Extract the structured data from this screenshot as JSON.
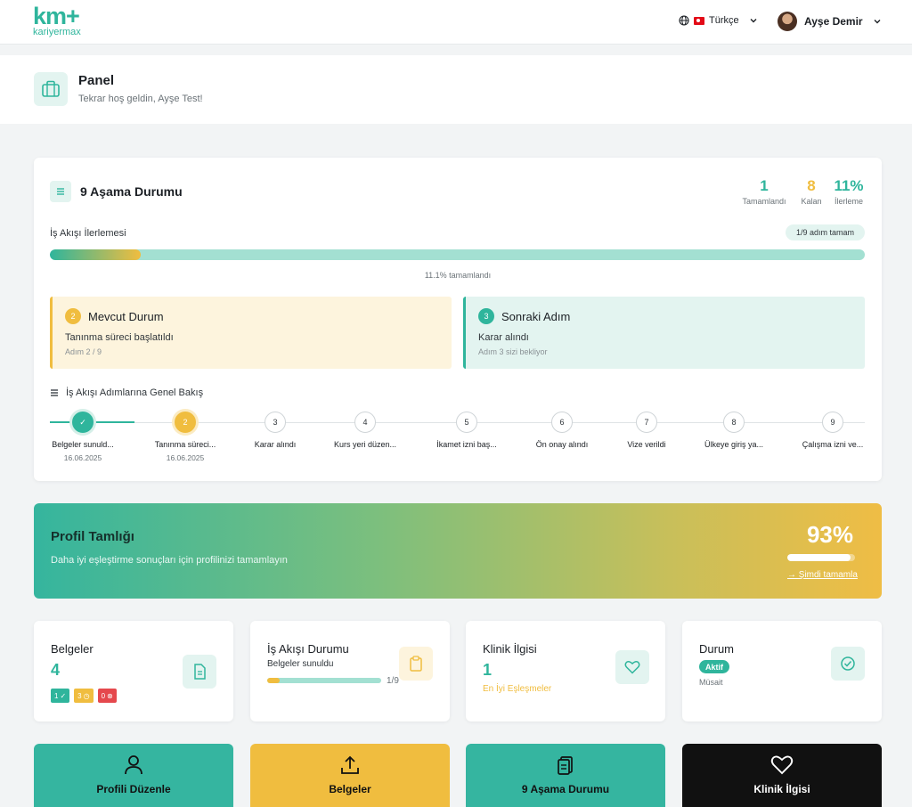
{
  "brand": {
    "logo": "km+",
    "name": "kariyermax"
  },
  "topbar": {
    "language": "Türkçe",
    "user_name": "Ayşe Demir"
  },
  "page": {
    "title": "Panel",
    "subtitle": "Tekrar hoş geldin, Ayşe Test!"
  },
  "stages": {
    "title": "9 Aşama Durumu",
    "stats": [
      {
        "value": "1",
        "label": "Tamamlandı",
        "color": "#2fb59c"
      },
      {
        "value": "8",
        "label": "Kalan",
        "color": "#f0bd3f"
      },
      {
        "value": "11%",
        "label": "İlerleme",
        "color": "#2fb59c"
      }
    ],
    "workflow_label": "İş Akışı İlerlemesi",
    "steps_done_pill": "1/9 adım tamam",
    "progress_fraction": 0.111,
    "progress_text": "11.1% tamamlandı",
    "current": {
      "badge": "2",
      "heading": "Mevcut Durum",
      "line1": "Tanınma süreci başlatıldı",
      "line2": "Adım 2 / 9"
    },
    "next": {
      "badge": "3",
      "heading": "Sonraki Adım",
      "line1": "Karar alındı",
      "line2": "Adım 3 sizi bekliyor"
    },
    "overview_title": "İş Akışı Adımlarına Genel Bakış",
    "steps": [
      {
        "num": "✓",
        "name": "Belgeler sunuld...",
        "date": "16.06.2025",
        "state": "done"
      },
      {
        "num": "2",
        "name": "Tanınma süreci...",
        "date": "16.06.2025",
        "state": "current"
      },
      {
        "num": "3",
        "name": "Karar alındı",
        "date": "",
        "state": "pending"
      },
      {
        "num": "4",
        "name": "Kurs yeri düzen...",
        "date": "",
        "state": "pending"
      },
      {
        "num": "5",
        "name": "İkamet izni baş...",
        "date": "",
        "state": "pending"
      },
      {
        "num": "6",
        "name": "Ön onay alındı",
        "date": "",
        "state": "pending"
      },
      {
        "num": "7",
        "name": "Vize verildi",
        "date": "",
        "state": "pending"
      },
      {
        "num": "8",
        "name": "Ülkeye giriş ya...",
        "date": "",
        "state": "pending"
      },
      {
        "num": "9",
        "name": "Çalışma izni ve...",
        "date": "",
        "state": "pending"
      }
    ]
  },
  "profile": {
    "title": "Profil Tamlığı",
    "subtitle": "Daha iyi eşleştirme sonuçları için profilinizi tamamlayın",
    "percent_text": "93%",
    "fraction": 0.93,
    "link": "→ Şimdi tamamla"
  },
  "cards": {
    "documents": {
      "title": "Belgeler",
      "count": "4",
      "chips": [
        "1",
        "3",
        "0"
      ]
    },
    "workflow": {
      "title": "İş Akışı Durumu",
      "sub": "Belgeler sunuldu",
      "fraction": 0.111,
      "frac_text": "1/9"
    },
    "clinic": {
      "title": "Klinik İlgisi",
      "count": "1",
      "sub": "En İyi Eşleşmeler"
    },
    "status": {
      "title": "Durum",
      "badge": "Aktif",
      "note": "Müsait"
    }
  },
  "actions": [
    {
      "label": "Profili Düzenle",
      "color": "#35b5a0"
    },
    {
      "label": "Belgeler",
      "color": "#f0bd3f"
    },
    {
      "label": "9 Aşama Durumu",
      "color": "#35b5a0"
    },
    {
      "label": "Klinik İlgisi",
      "color": "#111111"
    }
  ],
  "colors": {
    "accent": "#2fb59c",
    "warning": "#f0bd3f",
    "danger": "#e5484d"
  }
}
